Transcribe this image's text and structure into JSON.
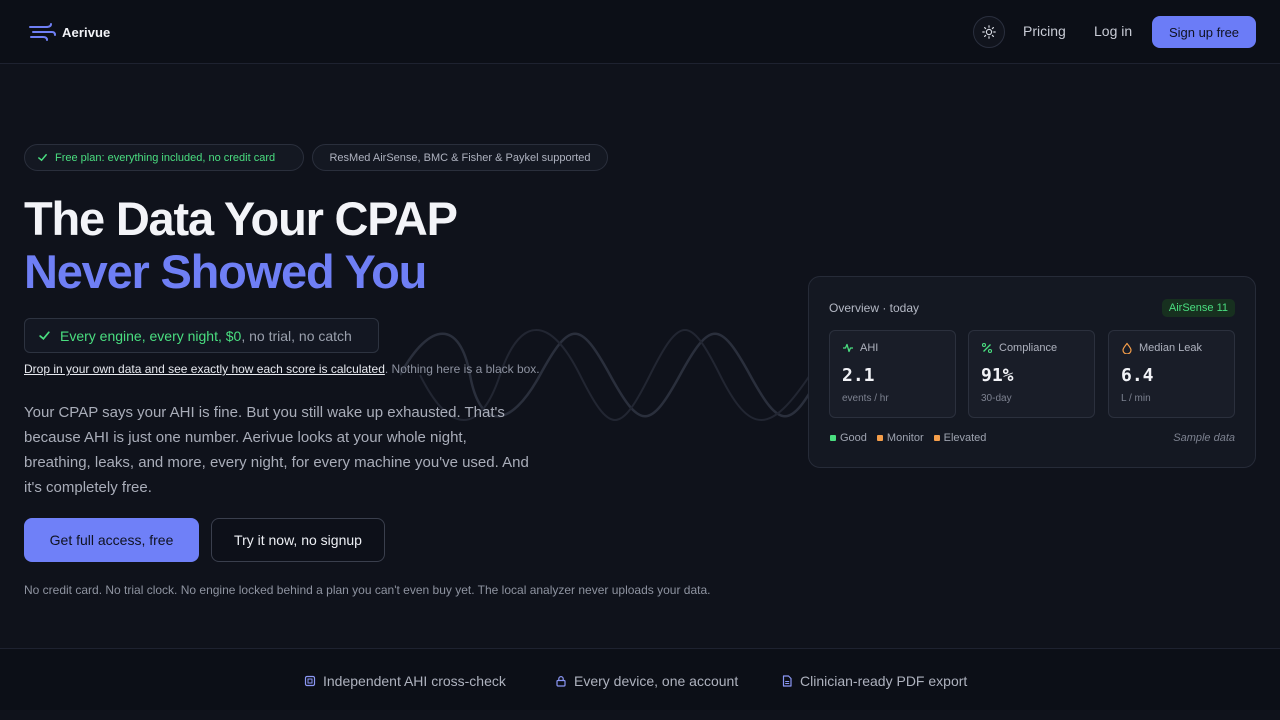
{
  "brand": {
    "name": "Aerivue"
  },
  "nav": {
    "pricing": "Pricing",
    "login": "Log in",
    "signup": "Sign up free"
  },
  "hero": {
    "pill_free": "Free plan: everything included, no credit card",
    "pill_devices": "ResMed AirSense, BMC & Fisher & Paykel supported",
    "title_line1": "The Data Your CPAP",
    "title_line2": "Never Showed You",
    "engine_highlight": "Every engine, every night, $0",
    "engine_rest": ", no trial, no catch",
    "drop_link": "Drop in your own data and see exactly how each score is calculated",
    "drop_rest": ". Nothing here is a black box.",
    "description": "Your CPAP says your AHI is fine. But you still wake up exhausted. That's because AHI is just one number. Aerivue looks at your whole night, breathing, leaks, and more, every night, for every machine you've used. And it's completely free.",
    "cta_primary": "Get full access, free",
    "cta_secondary": "Try it now, no signup",
    "fineprint": "No credit card. No trial clock. No engine locked behind a plan you can't even buy yet. The local analyzer never uploads your data."
  },
  "overview": {
    "title": "Overview · today",
    "device": "AirSense 11",
    "metrics": [
      {
        "label": "AHI",
        "value": "2.1",
        "unit": "events / hr",
        "icon": "pulse-icon",
        "color": "#4ade80"
      },
      {
        "label": "Compliance",
        "value": "91%",
        "unit": "30-day",
        "icon": "percent-icon",
        "color": "#4ade80"
      },
      {
        "label": "Median Leak",
        "value": "6.4",
        "unit": "L / min",
        "icon": "droplet-icon",
        "color": "#f59e4a"
      }
    ],
    "legend": [
      {
        "label": "Good",
        "color": "#4ade80"
      },
      {
        "label": "Monitor",
        "color": "#f59e4a"
      },
      {
        "label": "Elevated",
        "color": "#f59e4a"
      }
    ],
    "sample_label": "Sample data"
  },
  "features": [
    {
      "label": "Independent AHI cross-check",
      "icon": "chip-icon"
    },
    {
      "label": "Every device, one account",
      "icon": "lock-icon"
    },
    {
      "label": "Clinician-ready PDF export",
      "icon": "document-icon"
    }
  ],
  "colors": {
    "accent": "#6f7ff5",
    "good": "#4ade80",
    "warn": "#f59e4a",
    "background": "#0f121b"
  }
}
